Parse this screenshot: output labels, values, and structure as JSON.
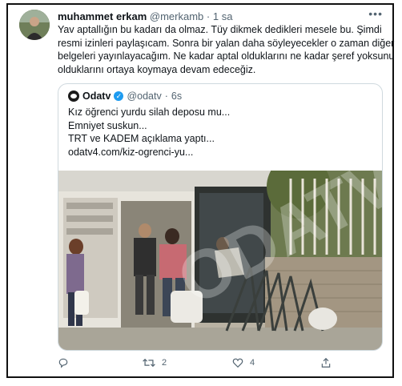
{
  "tweet": {
    "author_name": "muhammet erkam",
    "author_handle": "@merkamb",
    "separator": "·",
    "time": "1 sa",
    "more_icon": "more-icon",
    "text_lines": [
      "Yav aptallığın bu kadarı da olmaz. Tüy dikmek dedikleri mesele bu. Şimdi",
      "resmi izinleri paylaşıcam. Sonra bir yalan daha söyleyecekler o zaman diğer",
      "belgeleri yayınlayacağım. Ne kadar aptal olduklarını ne kadar şeref yoksunu",
      "olduklarını ortaya koymaya devam edeceğiz."
    ]
  },
  "quote": {
    "name": "Odatv",
    "verified_icon": "verified-icon",
    "handle": "@odatv",
    "separator": "·",
    "time": "6s",
    "text_lines": [
      "Kız öğrenci yurdu silah deposu mu...",
      "Emniyet suskun...",
      "TRT ve KADEM açıklama yaptı...",
      "odatv4.com/kiz-ogrenci-yu..."
    ],
    "photo_watermark": "ODATV"
  },
  "actions": {
    "reply_icon": "reply-icon",
    "retweet_icon": "retweet-icon",
    "retweet_count": "2",
    "like_icon": "like-icon",
    "like_count": "4",
    "share_icon": "share-icon"
  },
  "colors": {
    "text": "#0f1419",
    "secondary": "#536471",
    "border": "#cfd9de",
    "verified": "#1d9bf0"
  }
}
